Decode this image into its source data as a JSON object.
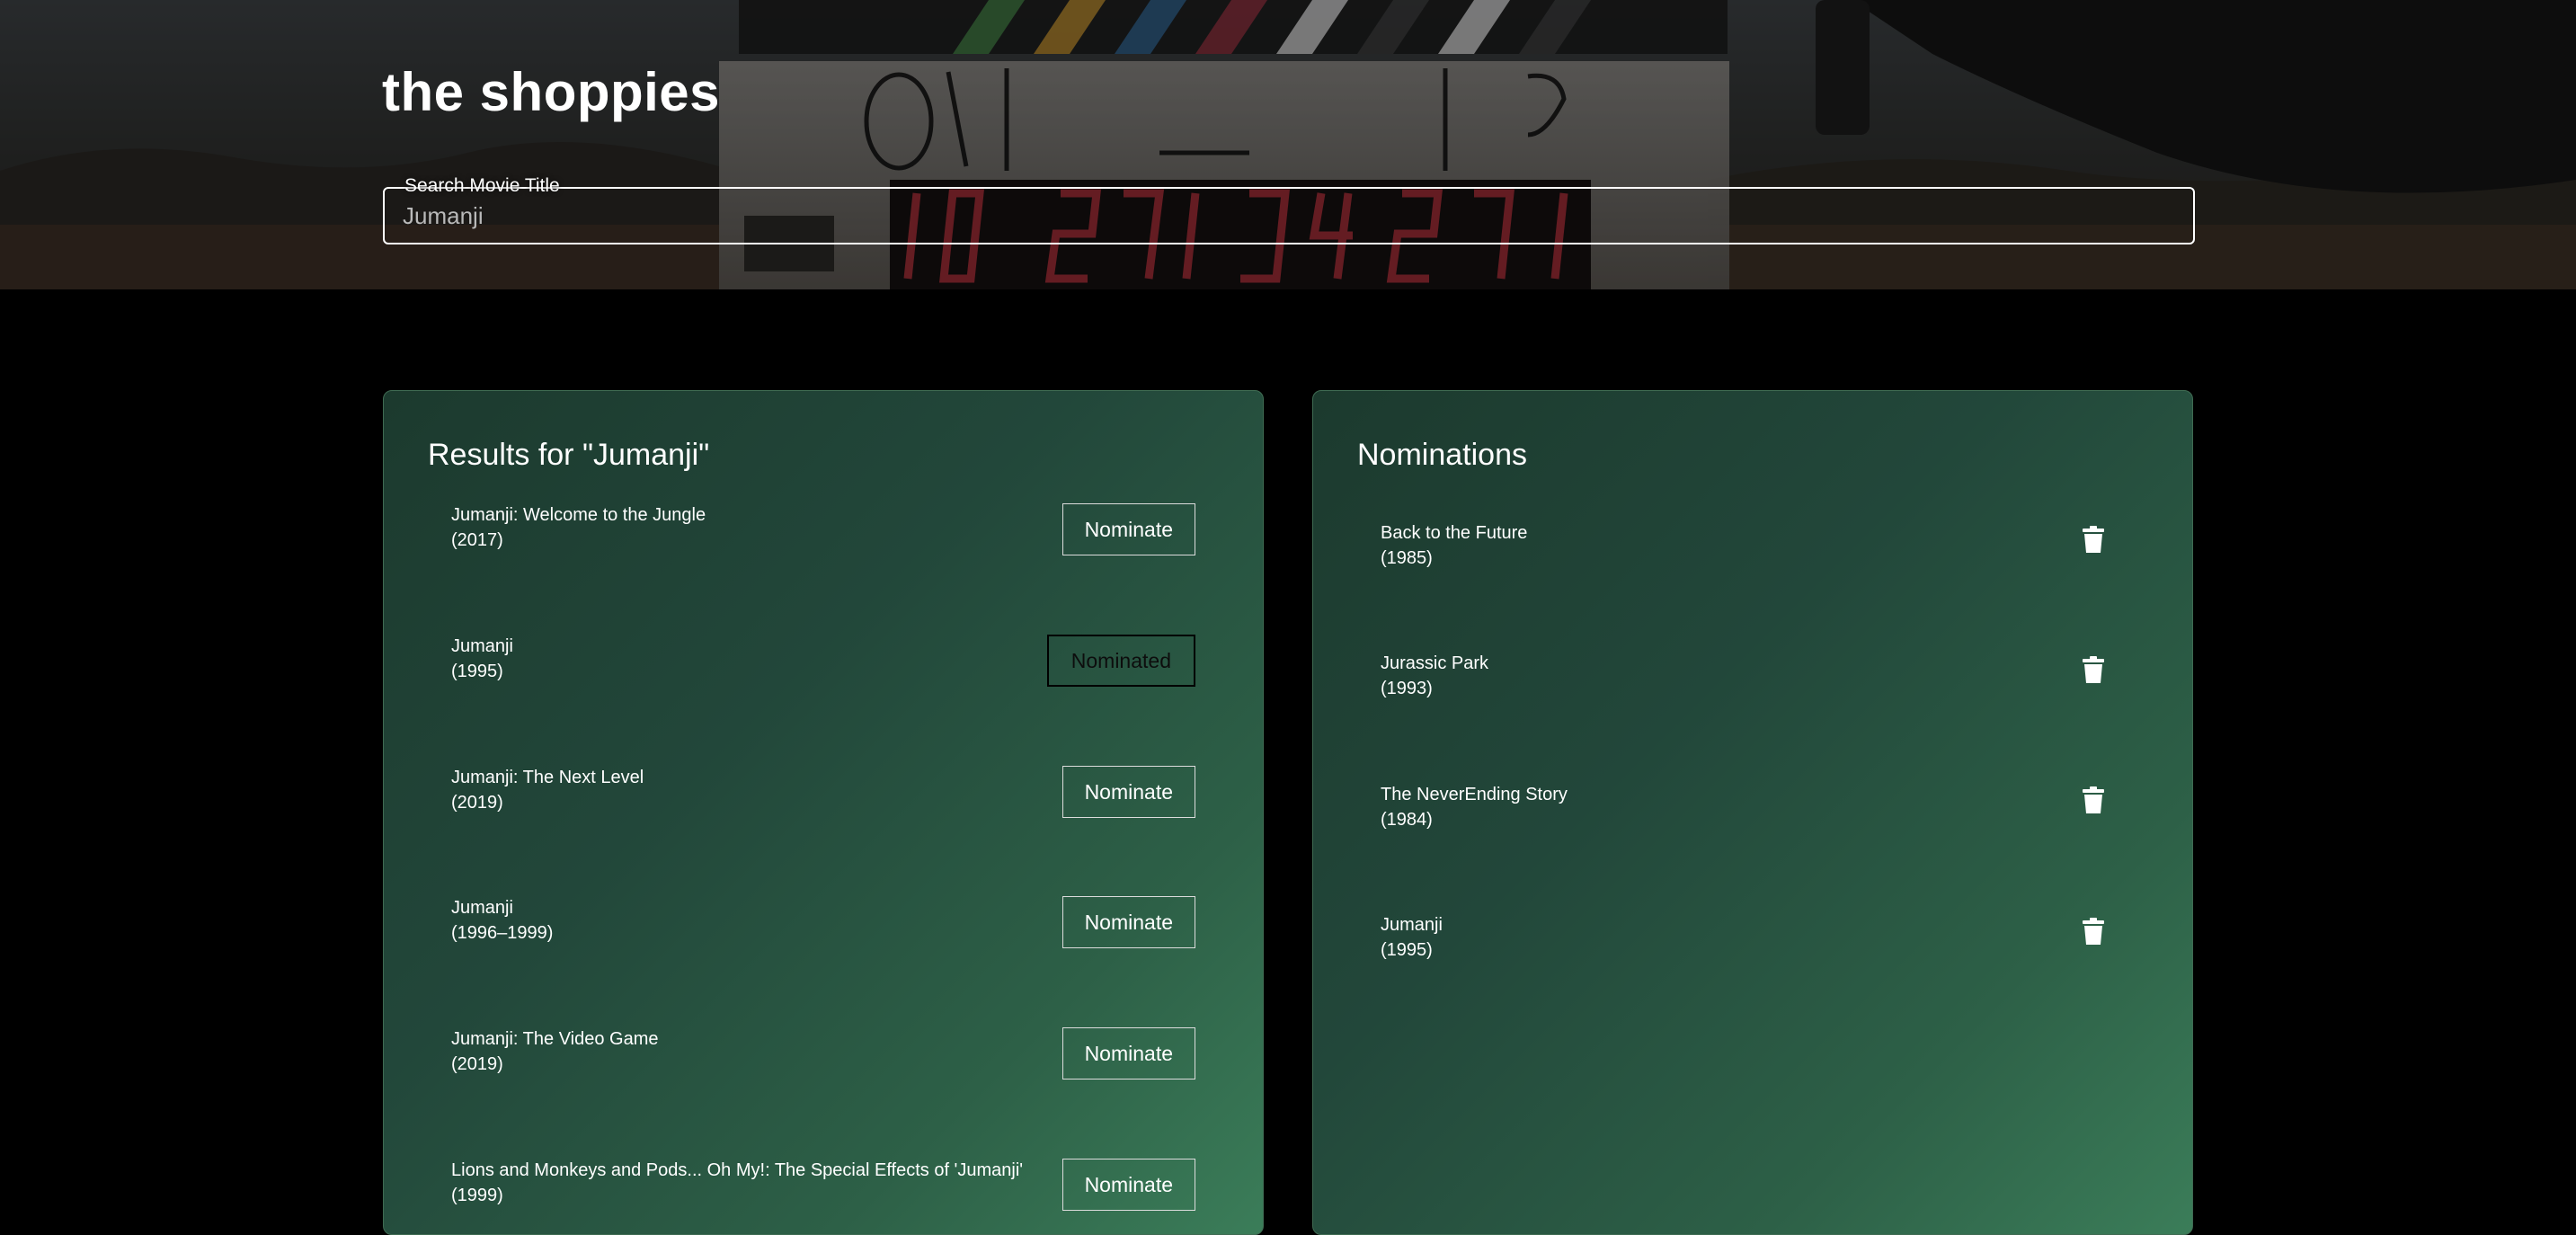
{
  "app": {
    "title": "the shoppies"
  },
  "search": {
    "label": "Search Movie Title",
    "value": "Jumanji",
    "placeholder": ""
  },
  "results": {
    "title": "Results for \"Jumanji\"",
    "items": [
      {
        "title": "Jumanji: Welcome to the Jungle",
        "year": "(2017)",
        "action": "Nominate"
      },
      {
        "title": "Jumanji",
        "year": "(1995)",
        "action": "Nominated"
      },
      {
        "title": "Jumanji: The Next Level",
        "year": "(2019)",
        "action": "Nominate"
      },
      {
        "title": "Jumanji",
        "year": "(1996–1999)",
        "action": "Nominate"
      },
      {
        "title": "Jumanji: The Video Game",
        "year": "(2019)",
        "action": "Nominate"
      },
      {
        "title": "Lions and Monkeys and Pods... Oh My!: The Special Effects of 'Jumanji'",
        "year": "(1999)",
        "action": "Nominate"
      }
    ]
  },
  "nominations": {
    "title": "Nominations",
    "items": [
      {
        "title": "Back to the Future",
        "year": "(1985)",
        "icon": "trash-icon"
      },
      {
        "title": "Jurassic Park",
        "year": "(1993)",
        "icon": "trash-icon"
      },
      {
        "title": "The NeverEnding Story",
        "year": "(1984)",
        "icon": "trash-icon"
      },
      {
        "title": "Jumanji",
        "year": "(1995)",
        "icon": "trash-icon"
      }
    ]
  },
  "colors": {
    "panel_dark": "#1c3a2e",
    "panel_light": "#3b7d59",
    "background": "#000000",
    "text": "#ffffff"
  }
}
